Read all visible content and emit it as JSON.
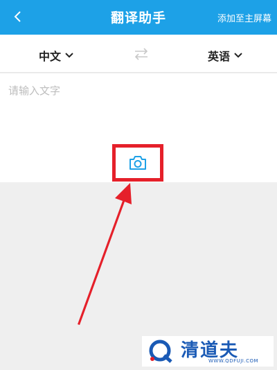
{
  "header": {
    "title": "翻译助手",
    "add_home_label": "添加至主屏幕"
  },
  "languages": {
    "source": "中文",
    "target": "英语"
  },
  "input": {
    "placeholder": "请输入文字"
  },
  "watermark": {
    "brand": "清道夫",
    "url": "WWW.QDFUJI.COM"
  },
  "colors": {
    "header_bg": "#1da1e7",
    "accent": "#1da1e7",
    "highlight_red": "#e5202a"
  },
  "icons": {
    "back": "chevron-left-icon",
    "dropdown": "chevron-down-icon",
    "swap": "swap-arrows-icon",
    "camera": "camera-icon"
  }
}
